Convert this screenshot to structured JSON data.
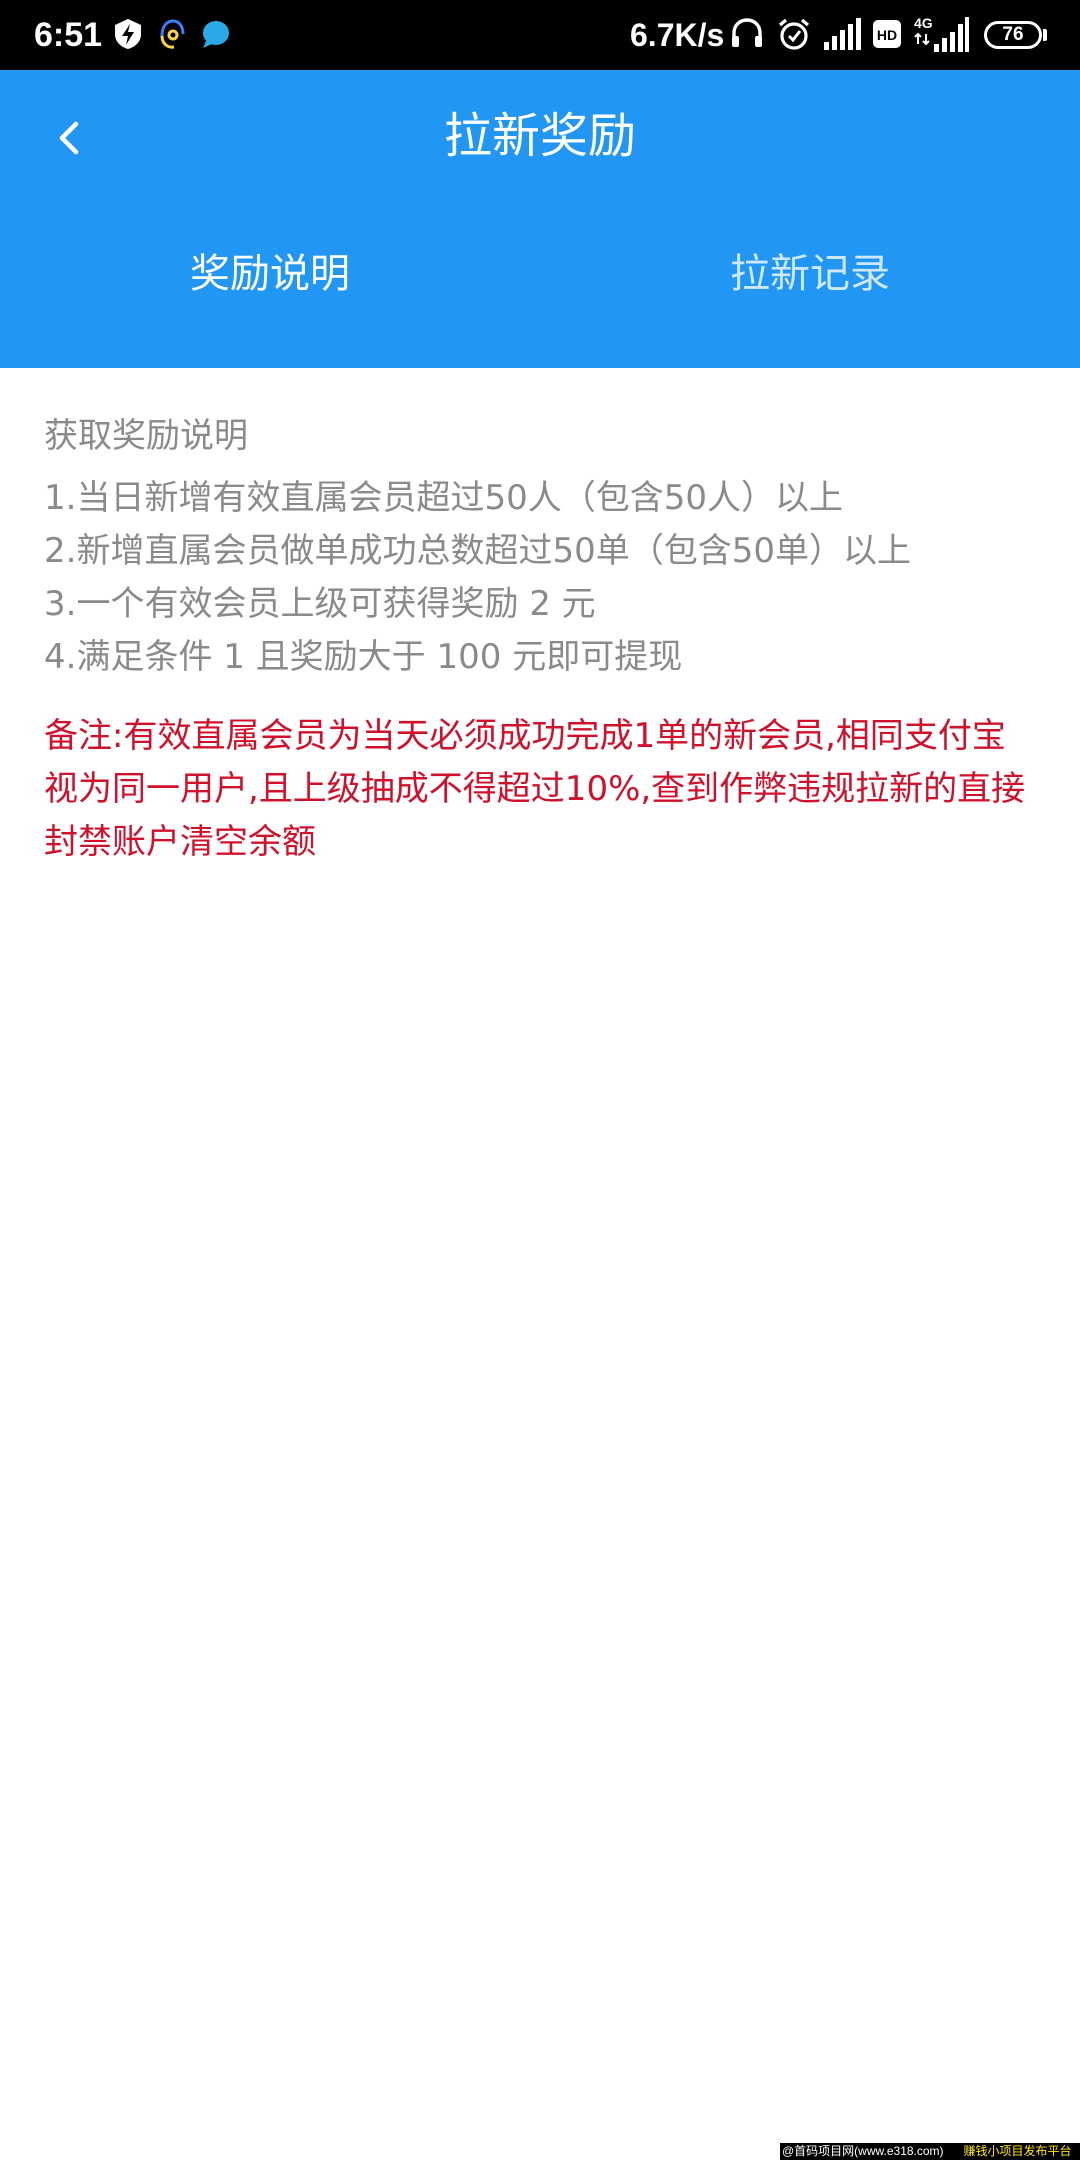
{
  "status_bar": {
    "time": "6:51",
    "net_speed": "6.7K/s",
    "battery": "76",
    "network": "4G",
    "hd": "HD",
    "icons": [
      "flash-icon",
      "headset-icon",
      "app-bubble-icon",
      "headphones-icon",
      "alarm-icon",
      "signal-icon",
      "hd-icon",
      "signal-4g-icon",
      "battery-icon"
    ]
  },
  "header": {
    "title": "拉新奖励",
    "back_icon": "chevron-left-icon",
    "tabs": [
      {
        "label": "奖励说明",
        "active": true
      },
      {
        "label": "拉新记录",
        "active": false
      }
    ]
  },
  "content": {
    "section_title": "获取奖励说明",
    "rules": [
      "1.当日新增有效直属会员超过50人（包含50人）以上",
      "2.新增直属会员做单成功总数超过50单（包含50单）以上",
      "3.一个有效会员上级可获得奖励 2 元",
      "4.满足条件 1 且奖励大于 100 元即可提现"
    ],
    "remark": "备注:有效直属会员为当天必须成功完成1单的新会员,相同支付宝视为同一用户,且上级抽成不得超过10%,查到作弊违规拉新的直接封禁账户清空余额"
  },
  "watermark": {
    "left": "@首码项目网(www.e318.com)",
    "right": "赚钱小项目发布平台"
  },
  "colors": {
    "header_bg": "#2196f3",
    "status_bg": "#000000",
    "text_gray": "#8a8a8a",
    "remark_red": "#d0112b"
  }
}
